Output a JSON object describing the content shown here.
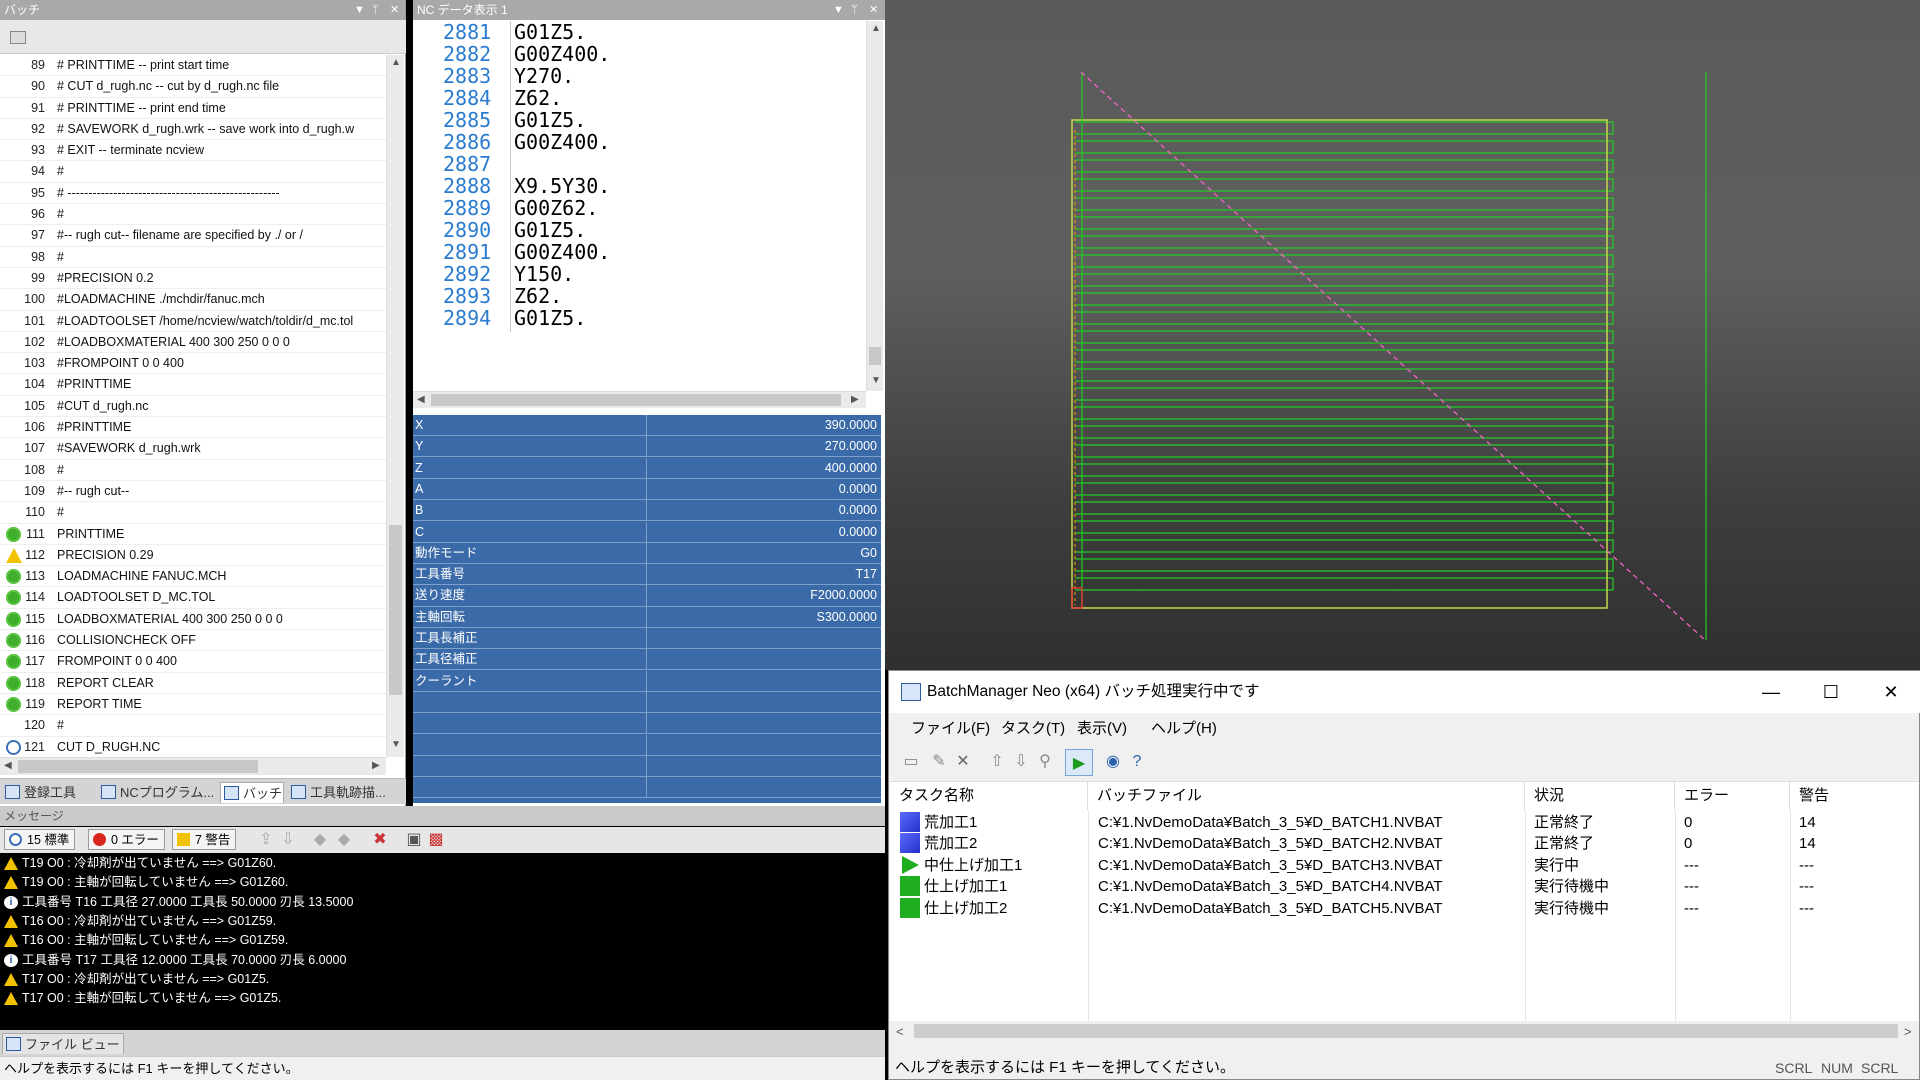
{
  "batch_pane": {
    "title": "バッチ",
    "lines": [
      {
        "n": "89",
        "t": "#     PRINTTIME     -- print start time",
        "s": ""
      },
      {
        "n": "90",
        "t": "#     CUT d_rugh.nc    -- cut by d_rugh.nc file",
        "s": ""
      },
      {
        "n": "91",
        "t": "#     PRINTTIME     -- print end time",
        "s": ""
      },
      {
        "n": "92",
        "t": "#     SAVEWORK d_rugh.wrk   -- save work into d_rugh.w",
        "s": ""
      },
      {
        "n": "93",
        "t": "#     EXIT     -- terminate ncview",
        "s": ""
      },
      {
        "n": "94",
        "t": "#",
        "s": ""
      },
      {
        "n": "95",
        "t": "#   ---------------------------------------------------",
        "s": ""
      },
      {
        "n": "96",
        "t": "#",
        "s": ""
      },
      {
        "n": "97",
        "t": "#-- rugh cut-- filename are specified by ./ or /",
        "s": ""
      },
      {
        "n": "98",
        "t": "#",
        "s": ""
      },
      {
        "n": "99",
        "t": "#PRECISION 0.2",
        "s": ""
      },
      {
        "n": "100",
        "t": "#LOADMACHINE ./mchdir/fanuc.mch",
        "s": ""
      },
      {
        "n": "101",
        "t": "#LOADTOOLSET /home/ncview/watch/toldir/d_mc.tol",
        "s": ""
      },
      {
        "n": "102",
        "t": "#LOADBOXMATERIAL 400 300 250 0 0 0",
        "s": ""
      },
      {
        "n": "103",
        "t": "#FROMPOINT 0 0 400",
        "s": ""
      },
      {
        "n": "104",
        "t": "#PRINTTIME",
        "s": ""
      },
      {
        "n": "105",
        "t": "#CUT d_rugh.nc",
        "s": ""
      },
      {
        "n": "106",
        "t": "#PRINTTIME",
        "s": ""
      },
      {
        "n": "107",
        "t": "#SAVEWORK d_rugh.wrk",
        "s": ""
      },
      {
        "n": "108",
        "t": "#",
        "s": ""
      },
      {
        "n": "109",
        "t": "#-- rugh cut--",
        "s": ""
      },
      {
        "n": "110",
        "t": "#",
        "s": ""
      },
      {
        "n": "111",
        "t": "PRINTTIME",
        "s": "ok"
      },
      {
        "n": "112",
        "t": "PRECISION 0.29",
        "s": "warn"
      },
      {
        "n": "113",
        "t": "LOADMACHINE FANUC.MCH",
        "s": "ok"
      },
      {
        "n": "114",
        "t": "LOADTOOLSET D_MC.TOL",
        "s": "ok"
      },
      {
        "n": "115",
        "t": "LOADBOXMATERIAL 400 300 250 0 0 0",
        "s": "ok"
      },
      {
        "n": "116",
        "t": "COLLISIONCHECK OFF",
        "s": "ok"
      },
      {
        "n": "117",
        "t": "FROMPOINT 0 0 400",
        "s": "ok"
      },
      {
        "n": "118",
        "t": "REPORT CLEAR",
        "s": "ok"
      },
      {
        "n": "119",
        "t": "REPORT TIME",
        "s": "ok"
      },
      {
        "n": "120",
        "t": "#",
        "s": ""
      },
      {
        "n": "121",
        "t": "CUT D_RUGH.NC",
        "s": "pause"
      }
    ],
    "tabs": [
      "登録工具",
      "NCプログラム...",
      "バッチ",
      "工具軌跡描..."
    ]
  },
  "nc_pane": {
    "title": "NC データ表示 1",
    "lines": [
      {
        "n": "2881",
        "c": "G01Z5."
      },
      {
        "n": "2882",
        "c": "G00Z400."
      },
      {
        "n": "2883",
        "c": "Y270."
      },
      {
        "n": "2884",
        "c": "Z62."
      },
      {
        "n": "2885",
        "c": "G01Z5."
      },
      {
        "n": "2886",
        "c": "G00Z400."
      },
      {
        "n": "2887",
        "c": ""
      },
      {
        "n": "2888",
        "c": "X9.5Y30."
      },
      {
        "n": "2889",
        "c": "G00Z62."
      },
      {
        "n": "2890",
        "c": "G01Z5."
      },
      {
        "n": "2891",
        "c": "G00Z400."
      },
      {
        "n": "2892",
        "c": "Y150."
      },
      {
        "n": "2893",
        "c": "Z62."
      },
      {
        "n": "2894",
        "c": "G01Z5."
      }
    ],
    "current_line": "2887",
    "table": [
      {
        "k": "X",
        "v": "390.0000"
      },
      {
        "k": "Y",
        "v": "270.0000"
      },
      {
        "k": "Z",
        "v": "400.0000"
      },
      {
        "k": "A",
        "v": "0.0000"
      },
      {
        "k": "B",
        "v": "0.0000"
      },
      {
        "k": "C",
        "v": "0.0000"
      },
      {
        "k": "動作モード",
        "v": "G0"
      },
      {
        "k": "工具番号",
        "v": "T17"
      },
      {
        "k": "送り速度",
        "v": "F2000.0000"
      },
      {
        "k": "主軸回転",
        "v": "S300.0000"
      },
      {
        "k": "工具長補正",
        "v": ""
      },
      {
        "k": "工具径補正",
        "v": ""
      },
      {
        "k": "クーラント",
        "v": ""
      },
      {
        "k": "",
        "v": ""
      },
      {
        "k": "",
        "v": ""
      },
      {
        "k": "",
        "v": ""
      },
      {
        "k": "",
        "v": ""
      },
      {
        "k": "",
        "v": ""
      }
    ]
  },
  "message_pane": {
    "title": "メッセージ",
    "btn_standard": "15 標準",
    "btn_error": "0 エラー",
    "btn_warning": "7 警告",
    "lines": [
      {
        "i": "w",
        "t": "T19 O0 : 冷却剤が出ていません    ==> G01Z60."
      },
      {
        "i": "w",
        "t": "T19 O0 : 主軸が回転していません    ==> G01Z60."
      },
      {
        "i": "i",
        "t": "工具番号  T16   工具径  27.0000   工具長  50.0000   刃長  13.5000"
      },
      {
        "i": "w",
        "t": "T16 O0 : 冷却剤が出ていません    ==> G01Z59."
      },
      {
        "i": "w",
        "t": "T16 O0 : 主軸が回転していません    ==> G01Z59."
      },
      {
        "i": "i",
        "t": "工具番号  T17   工具径  12.0000   工具長  70.0000   刃長  6.0000"
      },
      {
        "i": "w",
        "t": "T17 O0 : 冷却剤が出ていません    ==> G01Z5."
      },
      {
        "i": "w",
        "t": "T17 O0 : 主軸が回転していません    ==> G01Z5."
      }
    ],
    "file_tab": "ファイル ビュー",
    "status": "ヘルプを表示するには F1 キーを押してください。"
  },
  "batch_manager": {
    "title": "BatchManager Neo (x64) バッチ処理実行中です",
    "menus": [
      "ファイル(F)",
      "タスク(T)",
      "表示(V)",
      "ヘルプ(H)"
    ],
    "columns": [
      "タスク名称",
      "バッチファイル",
      "状況",
      "エラー",
      "警告"
    ],
    "rows": [
      {
        "icon": "blue",
        "name": "荒加工1",
        "file": "C:¥1.NvDemoData¥Batch_3_5¥D_BATCH1.NVBAT",
        "status": "正常終了",
        "err": "0",
        "warn": "14"
      },
      {
        "icon": "blue",
        "name": "荒加工2",
        "file": "C:¥1.NvDemoData¥Batch_3_5¥D_BATCH2.NVBAT",
        "status": "正常終了",
        "err": "0",
        "warn": "14"
      },
      {
        "icon": "play",
        "name": "中仕上げ加工1",
        "file": "C:¥1.NvDemoData¥Batch_3_5¥D_BATCH3.NVBAT",
        "status": "実行中",
        "err": "---",
        "warn": "---"
      },
      {
        "icon": "green",
        "name": "仕上げ加工1",
        "file": "C:¥1.NvDemoData¥Batch_3_5¥D_BATCH4.NVBAT",
        "status": "実行待機中",
        "err": "---",
        "warn": "---"
      },
      {
        "icon": "green",
        "name": "仕上げ加工2",
        "file": "C:¥1.NvDemoData¥Batch_3_5¥D_BATCH5.NVBAT",
        "status": "実行待機中",
        "err": "---",
        "warn": "---"
      }
    ],
    "status": "ヘルプを表示するには F1 キーを押してください。",
    "indicators": [
      "SCRL",
      "NUM",
      "SCRL"
    ]
  },
  "colors": {
    "accent": "#3a6aa8",
    "ok": "#3fae2a",
    "warn": "#f2c200",
    "path": "#22cc22",
    "rapid": "#ff66cc"
  }
}
